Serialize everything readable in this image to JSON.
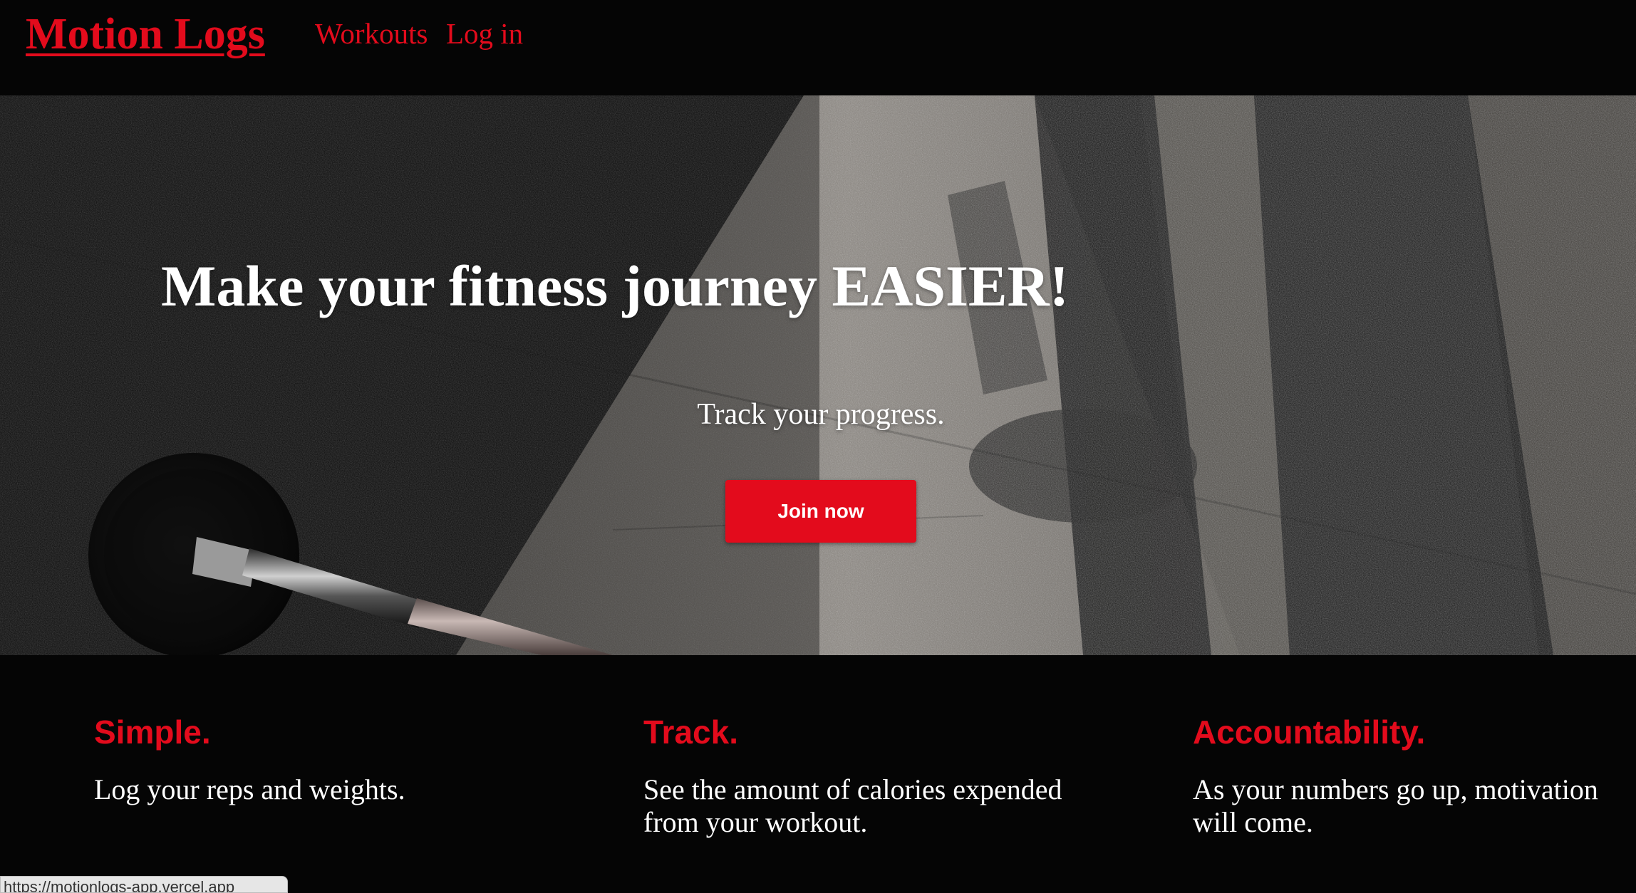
{
  "header": {
    "brand": "Motion Logs",
    "nav": [
      {
        "label": "Workouts"
      },
      {
        "label": "Log in"
      }
    ]
  },
  "hero": {
    "title": "Make your fitness journey EASIER!",
    "subtitle": "Track your progress.",
    "cta_label": "Join now"
  },
  "features": [
    {
      "title": "Simple.",
      "text": "Log your reps and weights."
    },
    {
      "title": "Track.",
      "text": "See the amount of calories expended from your workout."
    },
    {
      "title": "Accountability.",
      "text": "As your numbers go up, motivation will come."
    }
  ],
  "status_bar": {
    "url": "https://motionlogs-app.vercel.app"
  },
  "colors": {
    "accent": "#e30b1c",
    "background": "#050505",
    "text": "#ffffff"
  }
}
